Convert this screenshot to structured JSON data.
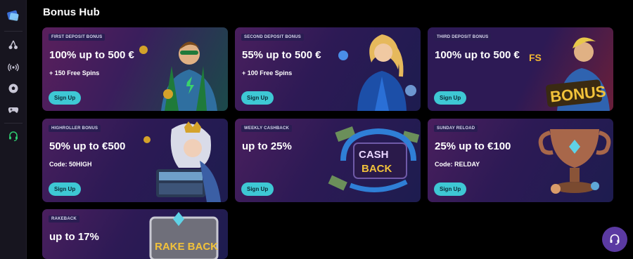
{
  "page": {
    "title": "Bonus Hub"
  },
  "sidebar": {
    "logo": "brand-logo",
    "items": [
      {
        "name": "sidebar-item-slots",
        "icon": "cherries-icon"
      },
      {
        "name": "sidebar-item-live",
        "icon": "broadcast-icon"
      },
      {
        "name": "sidebar-item-sports",
        "icon": "soccer-ball-icon"
      },
      {
        "name": "sidebar-item-esports",
        "icon": "gamepad-icon"
      },
      {
        "name": "sidebar-item-support",
        "icon": "headset-icon"
      }
    ]
  },
  "cards": [
    {
      "tag": "FIRST DEPOSIT BONUS",
      "headline": "100% up to 500 €",
      "sub": "+ 150 Free Spins",
      "cta": "Sign Up",
      "art": "superhero-icon"
    },
    {
      "tag": "SECOND DEPOSIT BONUS",
      "headline": "55% up to 500 €",
      "sub": "+ 100 Free Spins",
      "cta": "Sign Up",
      "art": "heroine-icon"
    },
    {
      "tag": "THIRD DEPOSIT BONUS",
      "headline": "100% up to 500 €",
      "sub": "",
      "cta": "Sign Up",
      "art": "bonus-badge-icon"
    },
    {
      "tag": "HIGHROLLER BONUS",
      "headline": "50% up to €500",
      "sub": "Code: 50HIGH",
      "cta": "Sign Up",
      "art": "treasure-queen-icon"
    },
    {
      "tag": "WEEKLY CASHBACK",
      "headline": "up to 25%",
      "sub": "",
      "cta": "Sign Up",
      "art": "cashback-sign-icon"
    },
    {
      "tag": "SUNDAY RELOAD",
      "headline": "25% up to €100",
      "sub": "Code: RELDAY",
      "cta": "Sign Up",
      "art": "trophy-icon"
    },
    {
      "tag": "RAKEBACK",
      "headline": "up to 17%",
      "sub": "",
      "cta": "",
      "art": "rakeback-sign-icon"
    }
  ],
  "art_text": {
    "bonus": "BONUS",
    "cash": "CASH",
    "back": "BACK",
    "rakeback": "RAKE BACK",
    "fs": "FS"
  },
  "colors": {
    "accent": "#3ec8d4",
    "support": "#5b3aa2",
    "sidebar_active": "#2ecc71"
  },
  "support": {
    "icon": "headset-icon"
  }
}
